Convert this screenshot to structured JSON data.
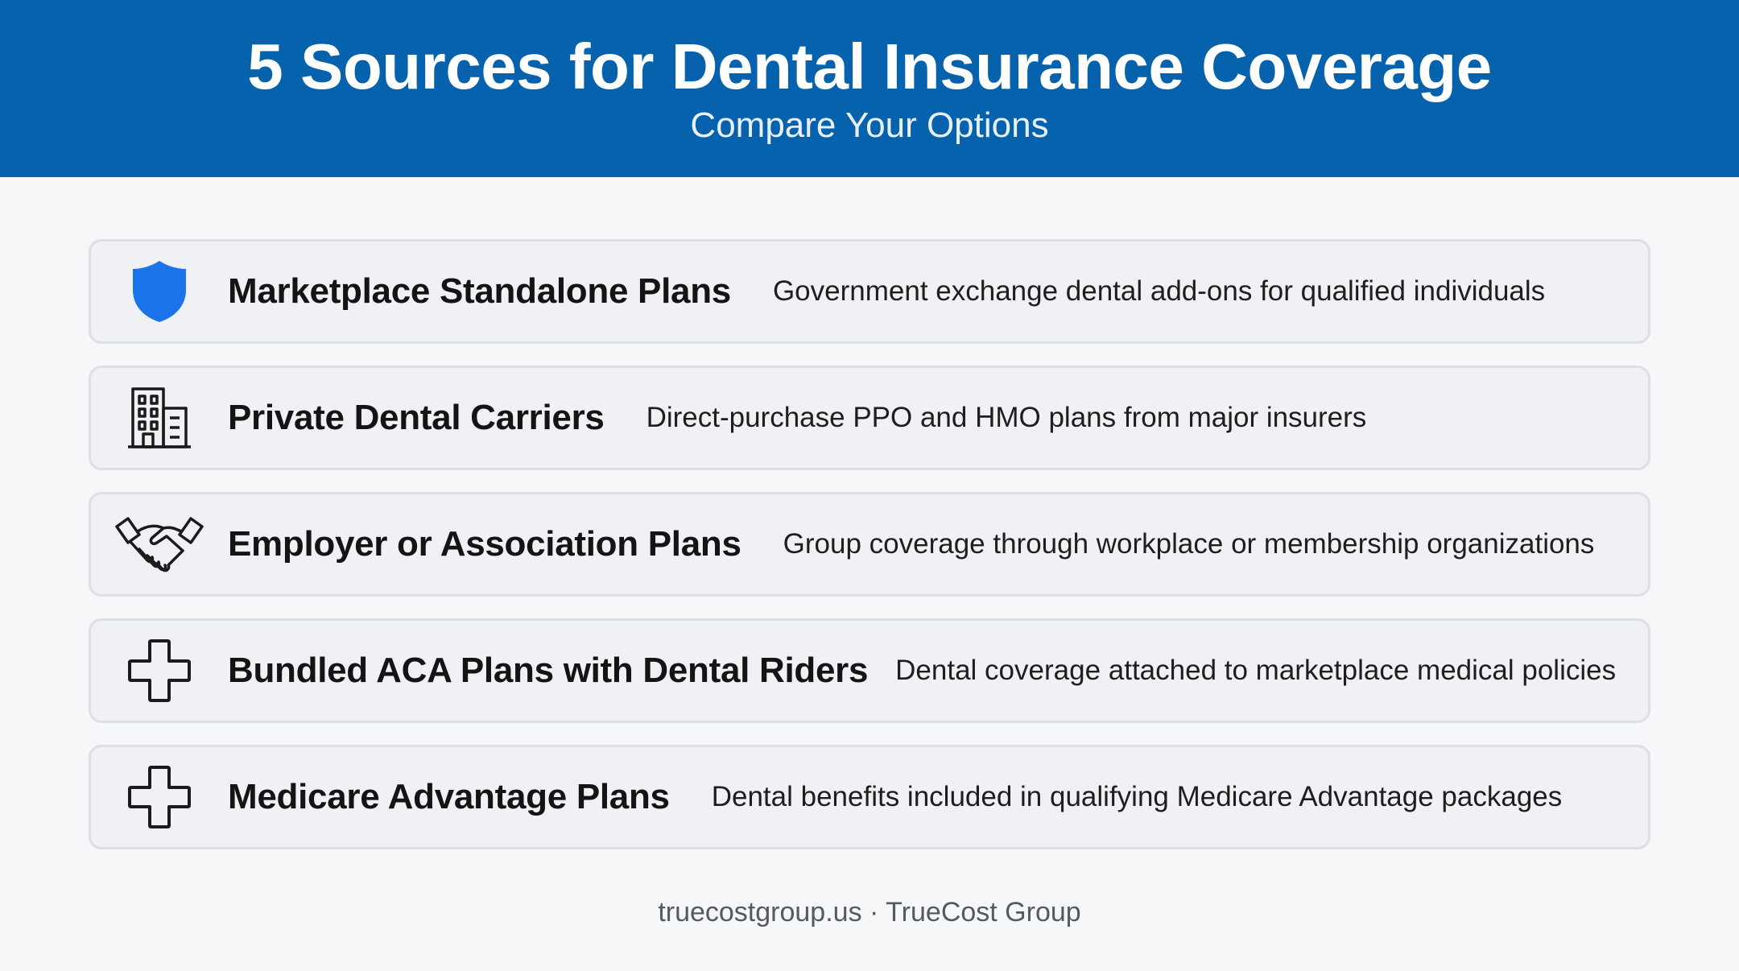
{
  "header": {
    "title": "5 Sources for Dental Insurance Coverage",
    "subtitle": "Compare Your Options",
    "background_color": "#0662ad"
  },
  "items": [
    {
      "icon": "shield-icon",
      "title": "Marketplace Standalone Plans",
      "description": "Government exchange dental add-ons for qualified individuals",
      "icon_color": "#1a73e8"
    },
    {
      "icon": "building-icon",
      "title": "Private Dental Carriers",
      "description": "Direct-purchase PPO and HMO plans from major insurers"
    },
    {
      "icon": "handshake-icon",
      "title": "Employer or Association Plans",
      "description": "Group coverage through workplace or membership organizations"
    },
    {
      "icon": "medical-cross-icon",
      "title": "Bundled ACA Plans with Dental Riders",
      "description": "Dental coverage attached to marketplace medical policies"
    },
    {
      "icon": "medical-cross-icon",
      "title": "Medicare Advantage Plans",
      "description": "Dental benefits included in qualifying Medicare Advantage packages"
    }
  ],
  "footer": {
    "text": "truecostgroup.us · TrueCost Group"
  }
}
